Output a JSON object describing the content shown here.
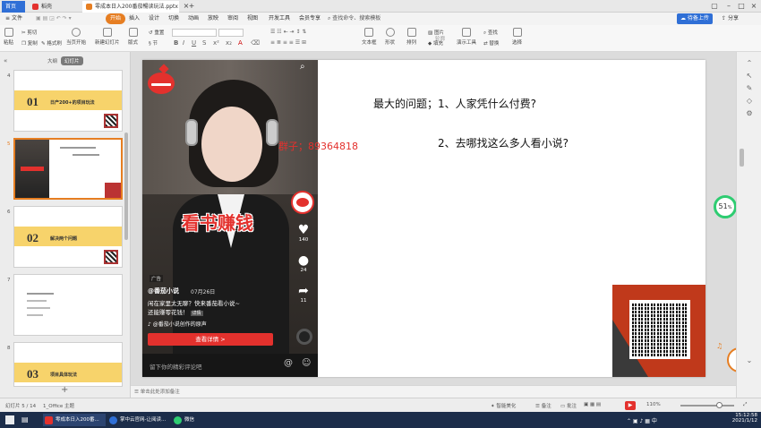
{
  "tabs": {
    "home": "首页",
    "daoke": "稻壳",
    "file": "零成本日入200番茄暢读玩法.pptx"
  },
  "menu": {
    "file": "文件",
    "items": [
      "开始",
      "插入",
      "设计",
      "切换",
      "动画",
      "放映",
      "审阅",
      "视图",
      "开发工具",
      "会员专享"
    ],
    "search": "查找命令、搜索模板",
    "upload": "待备上传",
    "share": "分享"
  },
  "toolbar": {
    "paste": "粘贴",
    "cut": "剪切",
    "copy": "复制",
    "format_painter": "格式刷",
    "from_current": "当页开始",
    "new_slide": "新建幻灯片",
    "layout": "版式",
    "section": "节",
    "reset": "重置",
    "textbox": "文本框",
    "shape": "形状",
    "arrange": "排列",
    "picture": "图片",
    "fill": "填充",
    "outline": "轮廓",
    "slide_show": "演示工具",
    "replace": "替换",
    "find": "查找",
    "select": "选择"
  },
  "panel": {
    "outline_tab": "大纲",
    "slides_tab": "幻灯片"
  },
  "thumbs": [
    {
      "num": "4",
      "big": "01",
      "text": "日产200+的项目玩法"
    },
    {
      "num": "5"
    },
    {
      "num": "6",
      "big": "02",
      "text": "解决两个问题"
    },
    {
      "num": "7"
    },
    {
      "num": "8",
      "big": "03",
      "text": "项目具体玩法"
    }
  ],
  "slide": {
    "question1": "最大的问题；1、人家凭什么付费?",
    "question2": "2、去哪找这么多人看小说?",
    "contact": "群子；89364818",
    "banner": "看书赚钱",
    "ad_label": "广告",
    "account": "@番茄小说",
    "date": "07月26日",
    "caption1": "闲在家里太无聊？快来番茄看小说~",
    "caption2": "还能赚零花钱！",
    "caption_tag": "详情",
    "sound": "@番茄小说创作的原声",
    "cta": "查看详情 >",
    "comment_placeholder": "留下你的精彩评论吧",
    "likes": "140",
    "comments": "24",
    "shares": "11"
  },
  "progress": {
    "value": "51",
    "unit": "%"
  },
  "notes_placeholder": "单击此处添加备注",
  "status": {
    "slide_count": "幻灯片 5 / 14",
    "theme": "1_Office 主题",
    "beautify": "智能美化",
    "notes": "备注",
    "comments": "批注",
    "zoom": "110%"
  },
  "taskbar": {
    "wps": "零成本日入200番...",
    "browser": "掌中云官网-让阅读...",
    "wechat": "微信",
    "time": "15:12:58",
    "date": "2021/1/12"
  },
  "colors": {
    "accent": "#e67e22",
    "red": "#e3312d",
    "yellow_band": "#f7d36b"
  }
}
